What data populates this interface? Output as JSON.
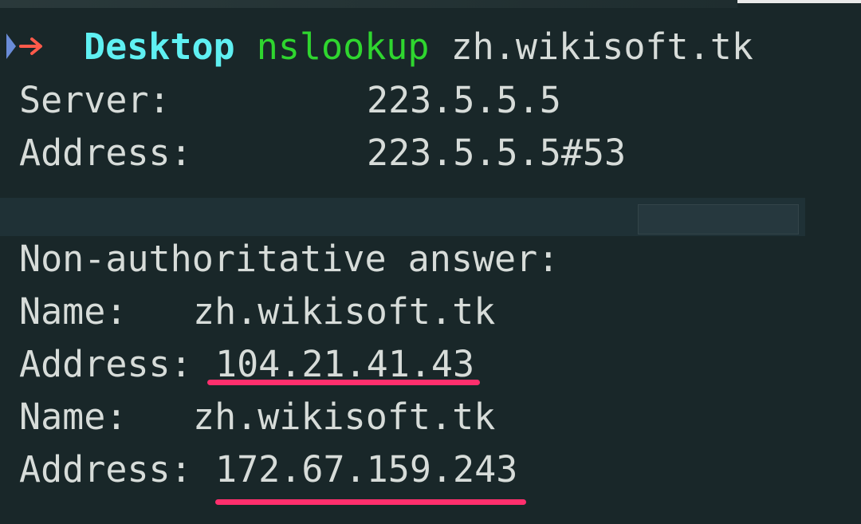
{
  "prompt": {
    "cwd": "Desktop",
    "command": "nslookup",
    "argument": "zh.wikisoft.tk"
  },
  "output": {
    "server_label": "Server:",
    "server_value": "223.5.5.5",
    "address_label": "Address:",
    "address_value": "223.5.5.5#53",
    "non_auth": "Non-authoritative answer:",
    "records": [
      {
        "name_label": "Name:",
        "name_value": "zh.wikisoft.tk",
        "address_label": "Address:",
        "address_value": "104.21.41.43"
      },
      {
        "name_label": "Name:",
        "name_value": "zh.wikisoft.tk",
        "address_label": "Address:",
        "address_value": "172.67.159.243"
      }
    ]
  },
  "colors": {
    "background": "#192729",
    "cwd": "#5ff0f2",
    "command": "#2fd62f",
    "text": "#d7dcd9",
    "arrow": "#ff5a4a",
    "highlight": "#ff2f6d"
  }
}
